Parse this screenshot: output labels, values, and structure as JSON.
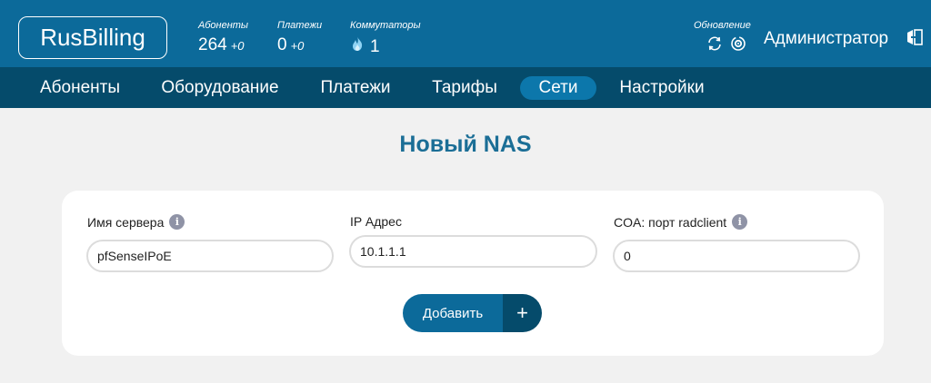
{
  "header": {
    "logo": "RusBilling",
    "stats": [
      {
        "label": "Абоненты",
        "value": "264",
        "delta": "+0"
      },
      {
        "label": "Платежи",
        "value": "0",
        "delta": "+0"
      },
      {
        "label": "Коммутаторы",
        "value": "1",
        "icon": "flame-icon"
      }
    ],
    "update_label": "Обновление",
    "user": "Администратор"
  },
  "nav": {
    "items": [
      "Абоненты",
      "Оборудование",
      "Платежи",
      "Тарифы",
      "Сети",
      "Настройки"
    ],
    "active": "Сети"
  },
  "page": {
    "title": "Новый NAS"
  },
  "form": {
    "server_name": {
      "label": "Имя сервера",
      "value": "pfSenseIPoE"
    },
    "ip_address": {
      "label": "IP Адрес",
      "value": "10.1.1.1"
    },
    "coa_port": {
      "label": "COA: порт radclient",
      "value": "0"
    },
    "submit_label": "Добавить",
    "submit_icon": "+"
  },
  "colors": {
    "header_bg": "#0c6a9a",
    "nav_bg": "#054b6b",
    "accent": "#1b6e96",
    "page_bg": "#f1f1f1"
  }
}
